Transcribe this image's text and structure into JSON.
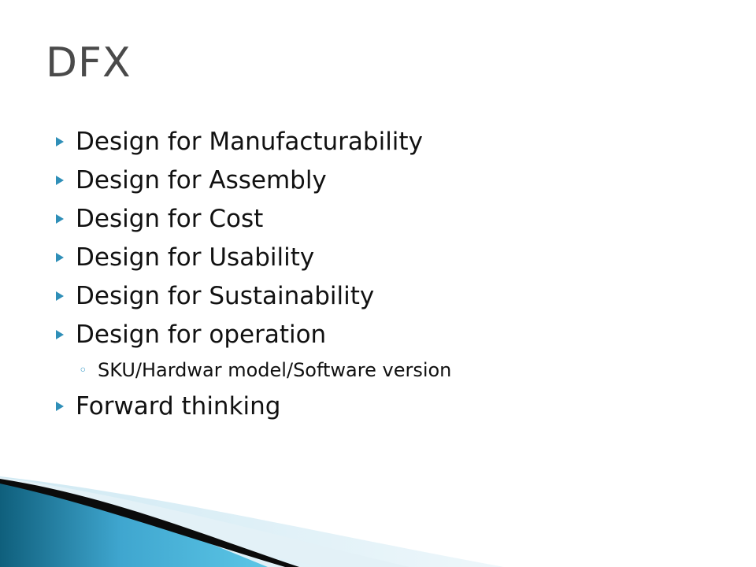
{
  "slide": {
    "title": "DFX",
    "items": [
      {
        "label": "Design for Manufacturability"
      },
      {
        "label": "Design for Assembly"
      },
      {
        "label": "Design for Cost"
      },
      {
        "label": "Design for Usability"
      },
      {
        "label": "Design for Sustainability"
      },
      {
        "label": "Design for operation",
        "subitems": [
          {
            "label": "SKU/Hardwar model/Software version"
          }
        ]
      },
      {
        "label": "Forward thinking"
      }
    ]
  },
  "colors": {
    "title": "#4a4a4a",
    "text": "#111111",
    "bullet": "#2f8fb8",
    "accent_dark": "#0f5f7c",
    "accent_light": "#5cc6e6"
  },
  "icons": {
    "bullet": "triangle-right",
    "sub_bullet": "ring"
  }
}
